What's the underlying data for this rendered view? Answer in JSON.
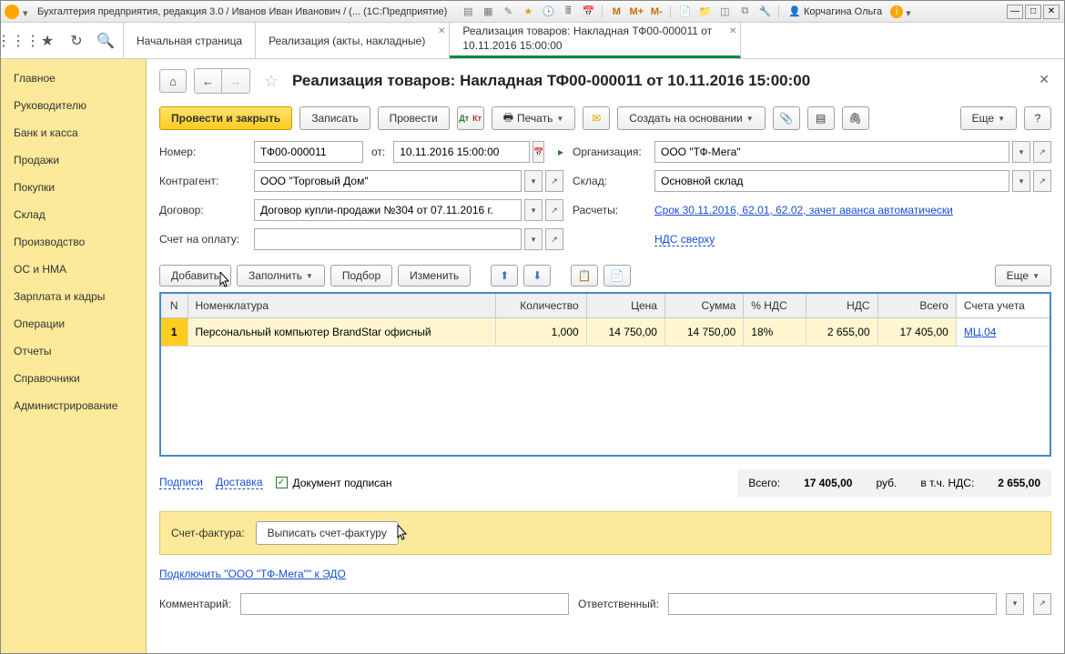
{
  "window": {
    "title": "Бухгалтерия предприятия, редакция 3.0 / Иванов Иван Иванович / (... (1С:Предприятие)",
    "user": "Корчагина Ольга"
  },
  "tabs": [
    {
      "label": "Начальная страница"
    },
    {
      "label": "Реализация (акты, накладные)"
    },
    {
      "label": "Реализация товаров: Накладная ТФ00-000011 от 10.11.2016 15:00:00",
      "active": true
    }
  ],
  "sidebar": {
    "items": [
      "Главное",
      "Руководителю",
      "Банк и касса",
      "Продажи",
      "Покупки",
      "Склад",
      "Производство",
      "ОС и НМА",
      "Зарплата и кадры",
      "Операции",
      "Отчеты",
      "Справочники",
      "Администрирование"
    ]
  },
  "page": {
    "title": "Реализация товаров: Накладная ТФ00-000011 от 10.11.2016 15:00:00"
  },
  "actions": {
    "post_close": "Провести и закрыть",
    "save": "Записать",
    "post": "Провести",
    "print": "Печать",
    "create_based": "Создать на основании",
    "more": "Еще"
  },
  "form": {
    "number_lbl": "Номер:",
    "number": "ТФ00-000011",
    "ot": "от:",
    "date": "10.11.2016 15:00:00",
    "org_lbl": "Организация:",
    "org": "ООО \"ТФ-Мега\"",
    "contr_lbl": "Контрагент:",
    "contr": "ООО \"Торговый Дом\"",
    "sklad_lbl": "Склад:",
    "sklad": "Основной склад",
    "dog_lbl": "Договор:",
    "dog": "Договор купли-продажи №304 от 07.11.2016 г.",
    "rasch_lbl": "Расчеты:",
    "rasch_link": "Срок 30.11.2016, 62.01, 62.02, зачет аванса автоматически",
    "schet_lbl": "Счет на оплату:",
    "nds_link": "НДС сверху"
  },
  "table_tb": {
    "add": "Добавить",
    "fill": "Заполнить",
    "pick": "Подбор",
    "change": "Изменить",
    "more": "Еще"
  },
  "table": {
    "cols": [
      "N",
      "Номенклатура",
      "Количество",
      "Цена",
      "Сумма",
      "% НДС",
      "НДС",
      "Всего",
      "Счета учета"
    ],
    "rows": [
      {
        "n": "1",
        "nom": "Персональный компьютер BrandStar офисный",
        "qty": "1,000",
        "price": "14 750,00",
        "sum": "14 750,00",
        "nds_pct": "18%",
        "nds": "2 655,00",
        "total": "17 405,00",
        "acct": "МЦ.04"
      }
    ]
  },
  "footer": {
    "podpisi": "Подписи",
    "dostavka": "Доставка",
    "signed": "Документ подписан",
    "vsego_lbl": "Всего:",
    "vsego": "17 405,00",
    "rub": "руб.",
    "vtch": "в т.ч. НДС:",
    "nds_total": "2 655,00",
    "sf_lbl": "Счет-фактура:",
    "sf_btn": "Выписать счет-фактуру",
    "edo_link": "Подключить \"ООО \"ТФ-Мега\"\" к ЭДО",
    "comment_lbl": "Комментарий:",
    "resp_lbl": "Ответственный:"
  }
}
